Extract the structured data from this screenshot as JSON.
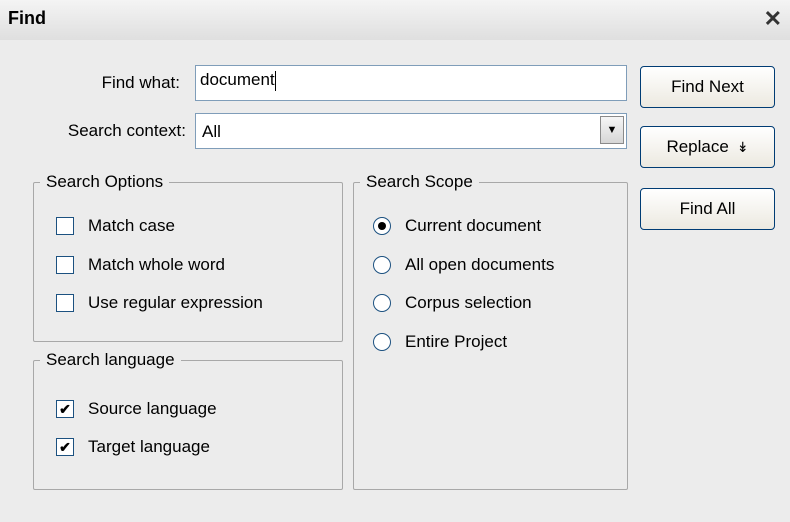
{
  "window": {
    "title": "Find",
    "close_symbol": "✕"
  },
  "find_what": {
    "label": "Find what:",
    "value": "document"
  },
  "search_context": {
    "label": "Search context:",
    "value": "All",
    "arrow_symbol": "▼"
  },
  "buttons": {
    "find_next": "Find Next",
    "replace": "Replace",
    "replace_symbol": "↡",
    "find_all": "Find All"
  },
  "search_options": {
    "legend": "Search Options",
    "items": [
      {
        "label": "Match case",
        "checked": false
      },
      {
        "label": "Match whole word",
        "checked": false
      },
      {
        "label": "Use regular expression",
        "checked": false
      }
    ]
  },
  "search_language": {
    "legend": "Search language",
    "items": [
      {
        "label": "Source language",
        "checked": true
      },
      {
        "label": "Target language",
        "checked": true
      }
    ]
  },
  "search_scope": {
    "legend": "Search Scope",
    "items": [
      {
        "label": "Current document",
        "selected": true
      },
      {
        "label": "All open documents",
        "selected": false
      },
      {
        "label": "Corpus selection",
        "selected": false
      },
      {
        "label": "Entire Project",
        "selected": false
      }
    ]
  },
  "check_mark": "✔"
}
